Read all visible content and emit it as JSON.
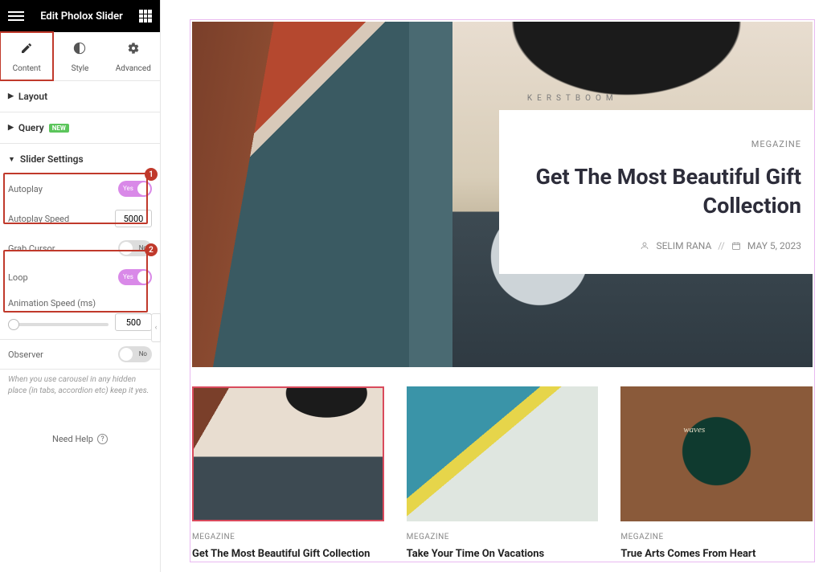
{
  "header": {
    "title": "Edit Pholox Slider"
  },
  "tabs": {
    "content": "Content",
    "style": "Style",
    "advanced": "Advanced"
  },
  "panels": {
    "layout": "Layout",
    "query": "Query",
    "query_badge": "NEW",
    "slider_settings": "Slider Settings"
  },
  "controls": {
    "autoplay": {
      "label": "Autoplay",
      "value": "Yes"
    },
    "autoplay_speed": {
      "label": "Autoplay Speed",
      "value": "5000"
    },
    "grab_cursor": {
      "label": "Grab Cursor",
      "value": "No"
    },
    "loop": {
      "label": "Loop",
      "value": "Yes"
    },
    "animation_speed": {
      "label": "Animation Speed (ms)",
      "value": "500"
    },
    "observer": {
      "label": "Observer",
      "value": "No"
    },
    "observer_help": "When you use carousel in any hidden place (in tabs, accordion etc) keep it yes."
  },
  "annotations": {
    "badge1": "1",
    "badge2": "2"
  },
  "footer": {
    "need_help": "Need Help"
  },
  "hero": {
    "category": "MEGAZINE",
    "title": "Get The Most Beautiful Gift Collection",
    "author": "SELIM RANA",
    "date": "MAY 5, 2023",
    "separator": "//"
  },
  "thumbs": [
    {
      "category": "MEGAZINE",
      "title": "Get The Most Beautiful Gift Collection"
    },
    {
      "category": "MEGAZINE",
      "title": "Take Your Time On Vacations"
    },
    {
      "category": "MEGAZINE",
      "title": "True Arts Comes From Heart"
    }
  ]
}
